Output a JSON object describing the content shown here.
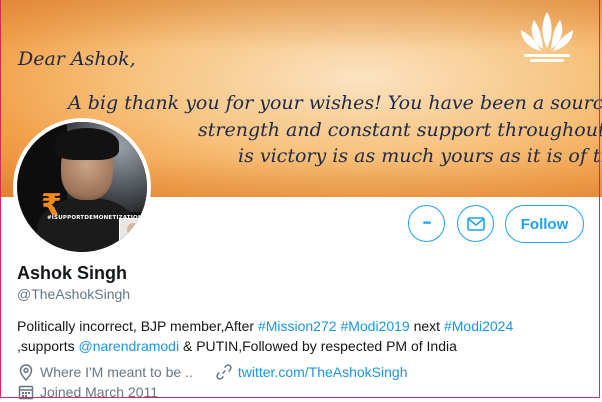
{
  "banner": {
    "line_dear": "Dear Ashok,",
    "line_1": "A big thank you for your wishes! You have been a source",
    "line_2": "strength and constant support throughout the",
    "line_3": "is victory is as much yours as it is of the BJP and"
  },
  "avatar": {
    "rupee_symbol": "₹",
    "tag_text": "#ISUPPORTDEMONETIZATION"
  },
  "actions": {
    "more_glyph": "•••",
    "follow_label": "Follow"
  },
  "profile": {
    "name": "Ashok Singh",
    "handle": "@TheAshokSingh",
    "bio": {
      "part1": "Politically incorrect, BJP member,After ",
      "tag1": "#Mission272",
      "sp1": " ",
      "tag2": "#Modi2019",
      "part2": " next ",
      "tag3": "#Modi2024",
      "part3": " ,supports ",
      "mention": "@narendramodi",
      "part4": " & PUTIN,Followed by respected PM of India"
    },
    "location": "Where I'M meant to be ..",
    "website": "twitter.com/TheAshokSingh",
    "joined": "Joined March 2011"
  },
  "colors": {
    "accent": "#1da1f2",
    "link": "#1b95e0",
    "secondary_text": "#657786",
    "border": "#e0245e"
  },
  "icons": [
    "more-icon",
    "mail-icon",
    "location-icon",
    "link-icon",
    "calendar-icon",
    "lotus-icon"
  ]
}
